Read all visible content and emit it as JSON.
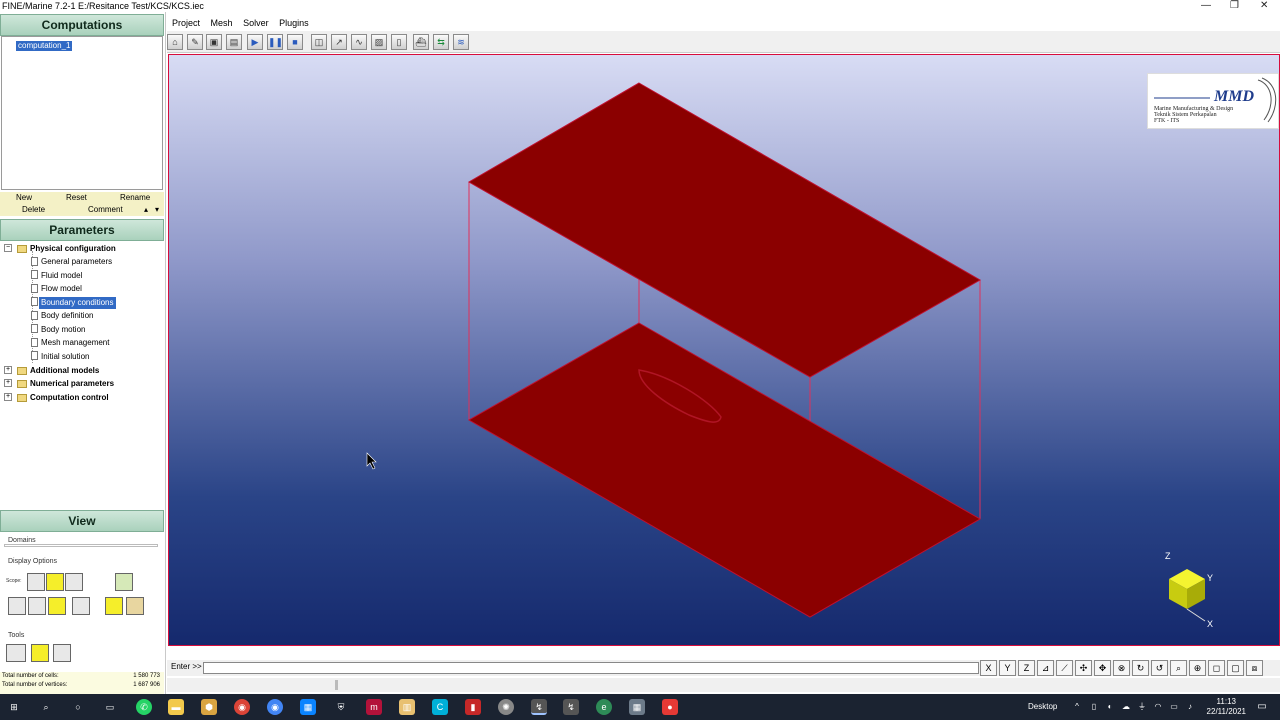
{
  "window": {
    "title": "FINE/Marine 7.2-1   E:/Resitance Test/KCS/KCS.iec",
    "controls": [
      "—",
      "❐",
      "✕"
    ]
  },
  "computations": {
    "header": "Computations",
    "items": [
      "computation_1"
    ],
    "buttons": {
      "new": "New",
      "reset": "Reset",
      "rename": "Rename",
      "delete": "Delete",
      "comment": "Comment"
    }
  },
  "parameters": {
    "header": "Parameters",
    "tree": [
      {
        "label": "Physical configuration",
        "expanded": true,
        "children": [
          "General parameters",
          "Fluid model",
          "Flow model",
          "Boundary conditions",
          "Body definition",
          "Body motion",
          "Mesh management",
          "Initial solution"
        ]
      },
      {
        "label": "Additional models",
        "expanded": false
      },
      {
        "label": "Numerical parameters",
        "expanded": false
      },
      {
        "label": "Computation control",
        "expanded": false
      }
    ],
    "selected": "Boundary conditions"
  },
  "view": {
    "header": "View",
    "domains_label": "Domains",
    "display_options_label": "Display Options",
    "scope_label": "Scope:",
    "tools_label": "Tools"
  },
  "stats": {
    "cells_label": "Total number of cells:",
    "cells_value": "1 580 773",
    "vertices_label": "Total number of vertices:",
    "vertices_value": "1 687 906"
  },
  "menu": [
    "Project",
    "Mesh",
    "Solver",
    "Plugins"
  ],
  "logo": {
    "brand": "MMD",
    "line1": "Marine Manufacturing & Design",
    "line2": "Teknik Sistem Perkapalan",
    "line3": "FTK - ITS"
  },
  "axes": {
    "z": "Z",
    "y": "Y",
    "x": "X"
  },
  "command": {
    "label": "Enter >>",
    "value": ""
  },
  "view_buttons": [
    "X",
    "Y",
    "Z"
  ],
  "taskbar": {
    "desktop_label": "Desktop",
    "time": "11:13",
    "date": "22/11/2021"
  },
  "colors": {
    "surface": "#8b0000",
    "edge": "#e0305a",
    "header_green": "#a9d1bc",
    "selection": "#316ac5"
  }
}
